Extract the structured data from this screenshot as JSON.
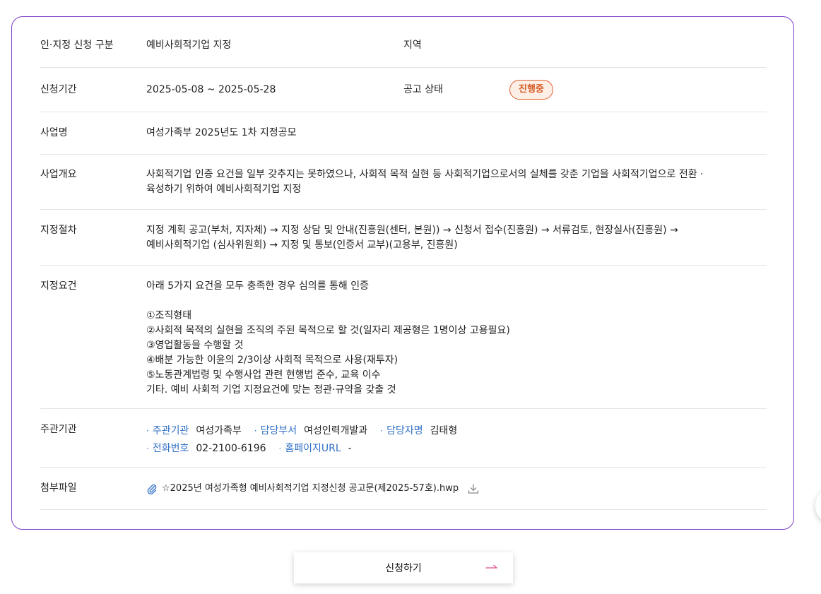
{
  "detail": {
    "type_label": "인·지정 신청 구분",
    "type_value": "예비사회적기업 지정",
    "region_label": "지역",
    "region_value": "",
    "period_label": "신청기간",
    "period_value": "2025-05-08 ~ 2025-05-28",
    "status_label": "공고 상태",
    "status_value": "진행중",
    "biz_name_label": "사업명",
    "biz_name_value": "여성가족부 2025년도 1차 지정공모",
    "overview_label": "사업개요",
    "overview_lines": [
      "사회적기업 인증 요건을 일부 갖추지는 못하였으나, 사회적 목적 실현 등 사회적기업으로서의 실체를 갖춘 기업을 사회적기업으로 전환 ·",
      "육성하기 위하여 예비사회적기업 지정"
    ],
    "procedure_label": "지정절차",
    "procedure_lines": [
      "지정 계획 공고(부처, 지자체) → 지정 상담 및 안내(진흥원(센터, 본원)) → 신청서 접수(진흥원) → 서류검토, 현장실사(진흥원) →",
      "예비사회적기업 (심사위원회) → 지정 및 통보(인증서 교부)(고용부, 진흥원)"
    ],
    "requirements_label": "지정요건",
    "requirements_intro": "아래 5가지 요건을 모두 충족한 경우 심의를 통해 인증",
    "requirements_items": [
      "①조직형태",
      "②사회적 목적의 실현을 조직의 주된 목적으로 할 것(일자리 제공형은 1명이상 고용필요)",
      "③영업활동을 수행할 것",
      "④배분 가능한 이윤의 2/3이상 사회적 목적으로 사용(재투자)",
      "⑤노동관계법령 및 수행사업 관련 현행법 준수, 교육 이수",
      "기타. 예비 사회적 기업 지정요건에 맞는 정관·규약을 갖출 것"
    ],
    "org_label": "주관기관",
    "org": {
      "agency_key": "주관기관",
      "agency_val": "여성가족부",
      "dept_key": "담당부서",
      "dept_val": "여성인력개발과",
      "manager_key": "담당자명",
      "manager_val": "김태형",
      "phone_key": "전화번호",
      "phone_val": "02-2100-6196",
      "url_key": "홈페이지URL",
      "url_val": "-",
      "bullet": "·"
    },
    "attach_label": "첨부파일",
    "attach_file": "☆2025년 여성가족형 예비사회적기업 지정신청 공고문(제2025-57호).hwp"
  },
  "apply_button": "신청하기",
  "icons": [
    "paperclip-icon",
    "download-icon",
    "arrow-right-icon"
  ],
  "colors": {
    "card_border": "#7d3fc8",
    "status_badge_border": "#e0602e",
    "status_badge_bg": "#fdeee6",
    "status_badge_text": "#d65a24",
    "org_key": "#2f6fc4",
    "arrow": "#e0508a"
  }
}
